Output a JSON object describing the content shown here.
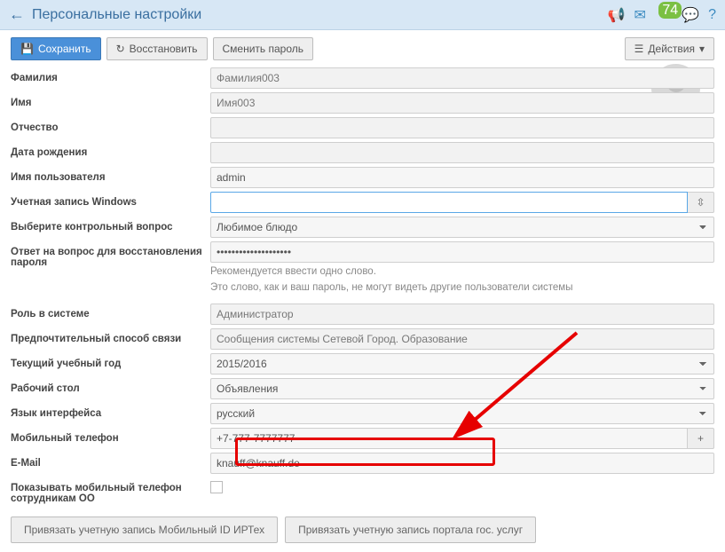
{
  "header": {
    "title": "Персональные настройки",
    "msg_badge": "74"
  },
  "toolbar": {
    "save": "Сохранить",
    "restore": "Восстановить",
    "change_pw": "Сменить пароль",
    "actions": "Действия"
  },
  "labels": {
    "surname": "Фамилия",
    "name": "Имя",
    "patronymic": "Отчество",
    "birthdate": "Дата рождения",
    "username": "Имя пользователя",
    "win_account": "Учетная запись Windows",
    "sec_question": "Выберите контрольный вопрос",
    "sec_answer": "Ответ на вопрос для восстановления пароля",
    "role": "Роль в системе",
    "contact_pref": "Предпочтительный способ связи",
    "school_year": "Текущий учебный год",
    "desktop": "Рабочий стол",
    "lang": "Язык интерфейса",
    "mobile": "Мобильный телефон",
    "email": "E-Mail",
    "show_mobile": "Показывать мобильный телефон сотрудникам ОО"
  },
  "values": {
    "surname": "Фамилия003",
    "name": "Имя003",
    "patronymic": "",
    "birthdate": "",
    "username": "admin",
    "win_account": "",
    "sec_question": "Любимое блюдо",
    "sec_answer": "••••••••••••••••••••",
    "role": "Администратор",
    "contact_pref": "Сообщения системы Сетевой Город. Образование",
    "school_year": "2015/2016",
    "desktop": "Объявления",
    "lang": "русский",
    "mobile": "+7-777-7777777",
    "email": "knauff@knauff.de"
  },
  "hints": {
    "answer1": "Рекомендуется ввести одно слово.",
    "answer2": "Это слово, как и ваш пароль, не могут видеть другие пользователи системы"
  },
  "bottom": {
    "bind_irtech": "Привязать учетную запись Мобильный ID ИРТех",
    "bind_gos": "Привязать учетную запись портала гос. услуг"
  }
}
